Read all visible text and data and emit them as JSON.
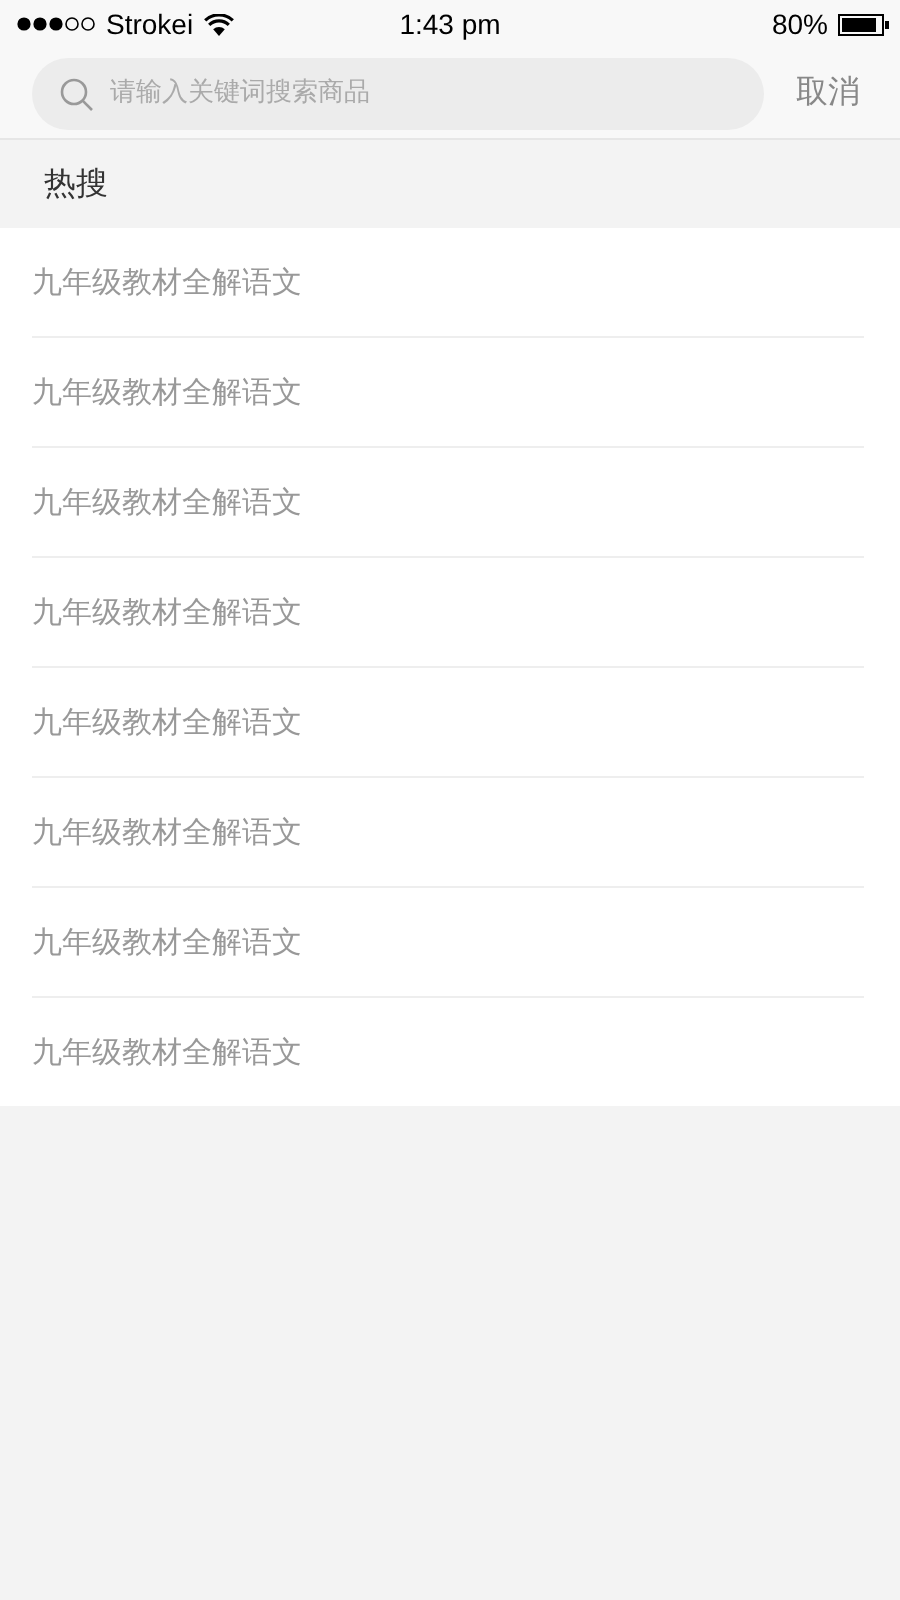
{
  "status_bar": {
    "carrier": "Strokei",
    "time": "1:43 pm",
    "battery": "80%"
  },
  "search": {
    "placeholder": "请输入关键词搜索商品",
    "cancel": "取消"
  },
  "hot_search": {
    "title": "热搜",
    "items": [
      "九年级教材全解语文",
      "九年级教材全解语文",
      "九年级教材全解语文",
      "九年级教材全解语文",
      "九年级教材全解语文",
      "九年级教材全解语文",
      "九年级教材全解语文",
      "九年级教材全解语文"
    ]
  }
}
